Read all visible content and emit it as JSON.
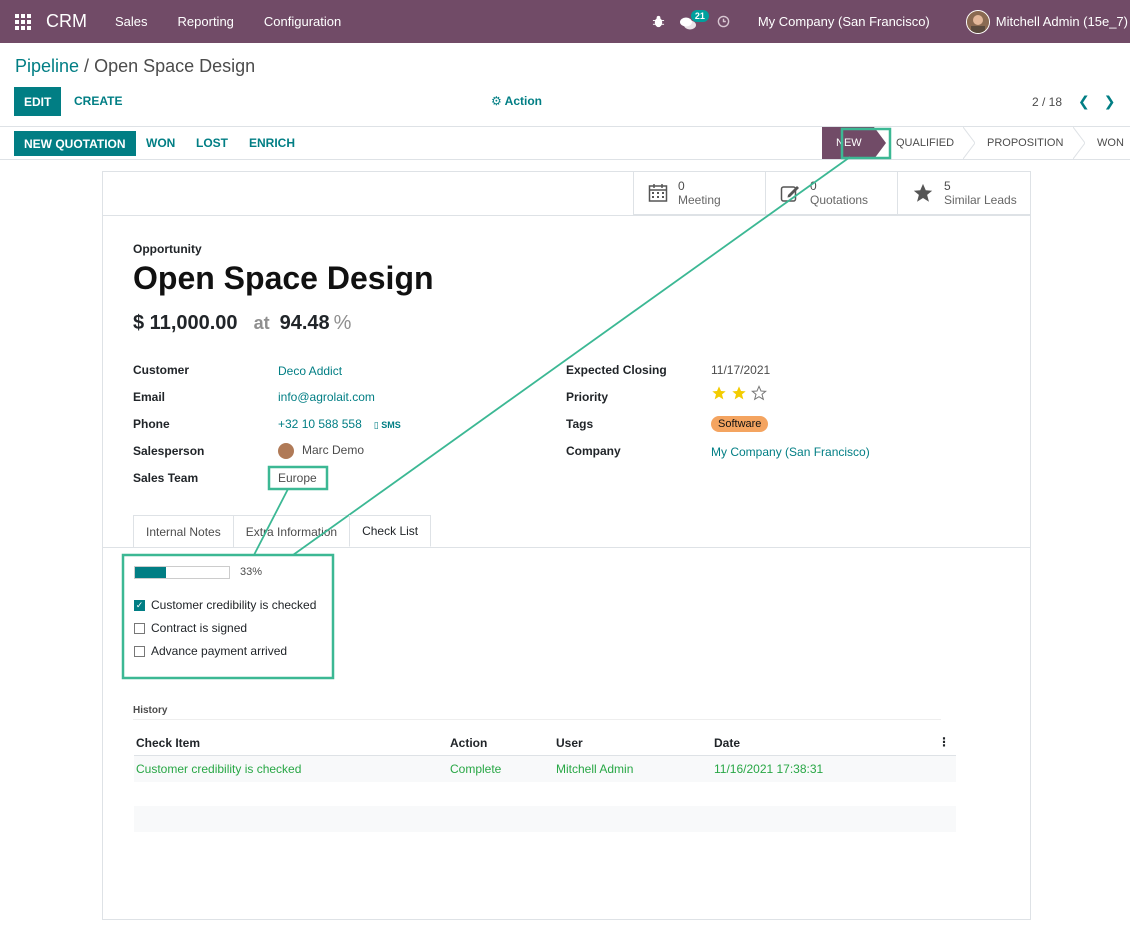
{
  "topbar": {
    "app_name": "CRM",
    "menu": [
      "Sales",
      "Reporting",
      "Configuration"
    ],
    "chat_count": "21",
    "company": "My Company (San Francisco)",
    "user": "Mitchell Admin (15e_7)"
  },
  "control": {
    "breadcrumb_parent": "Pipeline",
    "breadcrumb_sep": " / ",
    "breadcrumb_current": "Open Space Design",
    "edit_label": "EDIT",
    "create_label": "CREATE",
    "action_label": "Action",
    "pager": "2 / 18"
  },
  "statusbar": {
    "new_quotation": "NEW QUOTATION",
    "won": "WON",
    "lost": "LOST",
    "enrich": "ENRICH",
    "stages": [
      "NEW",
      "QUALIFIED",
      "PROPOSITION",
      "WON"
    ],
    "active_stage": "NEW"
  },
  "smart_buttons": [
    {
      "count": "0",
      "label": "Meeting",
      "icon": "calendar-icon"
    },
    {
      "count": "0",
      "label": "Quotations",
      "icon": "edit-icon"
    },
    {
      "count": "5",
      "label": "Similar Leads",
      "icon": "star-icon"
    }
  ],
  "form": {
    "type_label": "Opportunity",
    "title": "Open Space Design",
    "revenue": "$ 11,000.00",
    "at": "at",
    "probability": "94.48",
    "probability_unit": "%",
    "left_fields": {
      "customer_label": "Customer",
      "customer": "Deco Addict",
      "email_label": "Email",
      "email": "info@agrolait.com",
      "phone_label": "Phone",
      "phone": "+32 10 588 558",
      "sms": "SMS",
      "salesperson_label": "Salesperson",
      "salesperson": "Marc Demo",
      "team_label": "Sales Team",
      "team": "Europe"
    },
    "right_fields": {
      "closing_label": "Expected Closing",
      "closing": "11/17/2021",
      "priority_label": "Priority",
      "priority_stars": 2,
      "priority_max": 3,
      "tags_label": "Tags",
      "tag": "Software",
      "tag_color": "#F4A460",
      "company_label": "Company",
      "company": "My Company (San Francisco)"
    }
  },
  "tabs": [
    "Internal Notes",
    "Extra Information",
    "Check List"
  ],
  "active_tab": "Check List",
  "checklist": {
    "progress_pct": 33,
    "progress_label": "33%",
    "items": [
      {
        "label": "Customer credibility is checked",
        "checked": true
      },
      {
        "label": "Contract is signed",
        "checked": false
      },
      {
        "label": "Advance payment arrived",
        "checked": false
      }
    ]
  },
  "history": {
    "title": "History",
    "columns": [
      "Check Item",
      "Action",
      "User",
      "Date"
    ],
    "rows": [
      [
        "Customer credibility is checked",
        "Complete",
        "Mitchell Admin",
        "11/16/2021 17:38:31"
      ]
    ]
  },
  "colors": {
    "brand": "#714B67",
    "accent": "#017e84",
    "highlight": "#3CB894",
    "success": "#28a745"
  }
}
